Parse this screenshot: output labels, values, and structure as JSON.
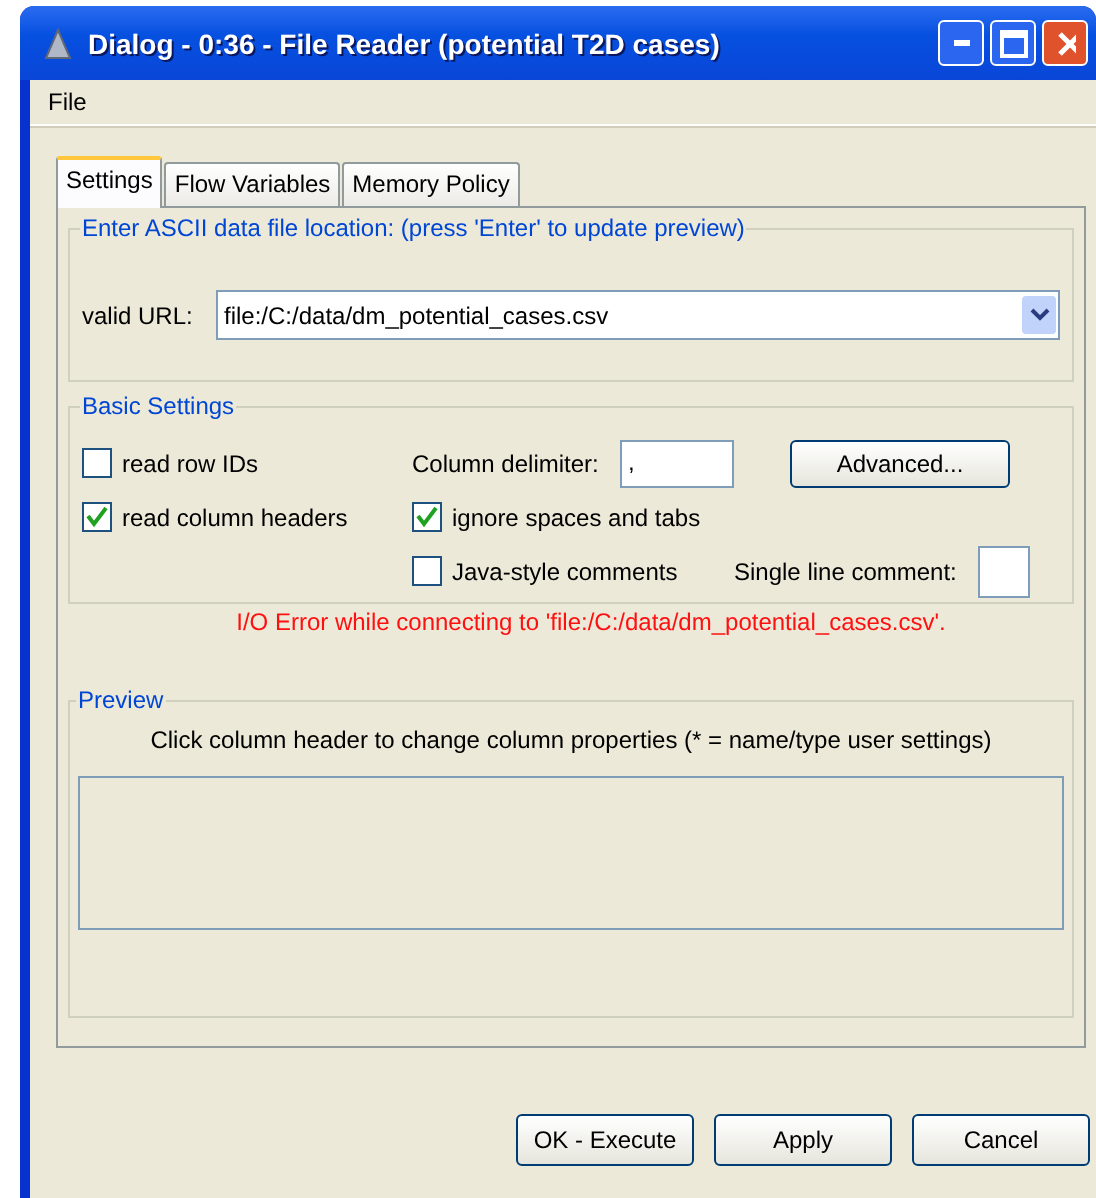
{
  "window": {
    "title": "Dialog - 0:36 - File Reader (potential T2D cases)"
  },
  "menu": [
    "File"
  ],
  "tabs": [
    {
      "label": "Settings",
      "selected": true
    },
    {
      "label": "Flow Variables",
      "selected": false
    },
    {
      "label": "Memory Policy",
      "selected": false
    }
  ],
  "location": {
    "legend": "Enter ASCII data file location: (press 'Enter' to update preview)",
    "label": "valid URL:",
    "value": "file:/C:/data/dm_potential_cases.csv"
  },
  "basic_settings": {
    "legend": "Basic Settings",
    "read_row_ids": {
      "label": "read row IDs",
      "checked": false
    },
    "column_delimiter": {
      "label": "Column delimiter:",
      "value": ","
    },
    "advanced_button": "Advanced...",
    "read_column_headers": {
      "label": "read column headers",
      "checked": true
    },
    "ignore_spaces": {
      "label": "ignore spaces and tabs",
      "checked": true
    },
    "java_comments": {
      "label": "Java-style comments",
      "checked": false
    },
    "single_line_comment": {
      "label": "Single line comment:"
    }
  },
  "error": "I/O Error while connecting to 'file:/C:/data/dm_potential_cases.csv'.",
  "preview": {
    "legend": "Preview",
    "hint": "Click column header to change column properties (* = name/type user settings)"
  },
  "buttons": [
    "OK - Execute",
    "Apply",
    "Cancel"
  ]
}
